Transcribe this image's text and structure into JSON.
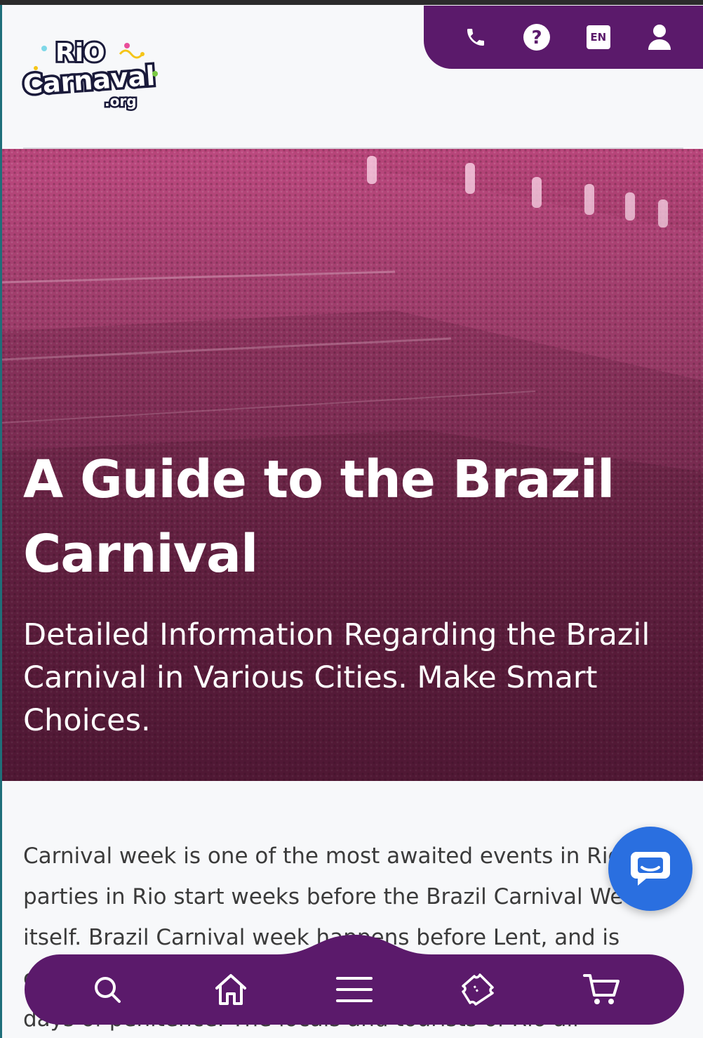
{
  "header": {
    "logo": {
      "line1": "RiO",
      "line2": "Carnaval",
      "line3": ".org"
    },
    "utility": {
      "phone_icon": "phone-icon",
      "help_icon": "question-icon",
      "language": "EN",
      "account_icon": "user-icon"
    }
  },
  "hero": {
    "title": "A Guide to the Brazil Carnival",
    "subtitle": "Detailed Information Regarding the Brazil Carnival in Various Cities. Make Smart Choices."
  },
  "article": {
    "paragraph": "Carnival week is one of the most awaited events in Rio, but parties in Rio start weeks before the Brazil Carnival Week itself. Brazil Carnival week happens before Lent, and is considered as the last time to celebrate before the forty days of penitence. The locals and tourists of Rio all participate in"
  },
  "chat": {
    "icon": "chat-icon"
  },
  "bottom_nav": {
    "items": [
      "search-icon",
      "home-icon",
      "menu-icon",
      "ticket-icon",
      "cart-icon"
    ]
  },
  "colors": {
    "brand_purple": "#5b1a6b",
    "hero_overlay": "#a13b6b",
    "chat_blue": "#2a6fe0"
  }
}
